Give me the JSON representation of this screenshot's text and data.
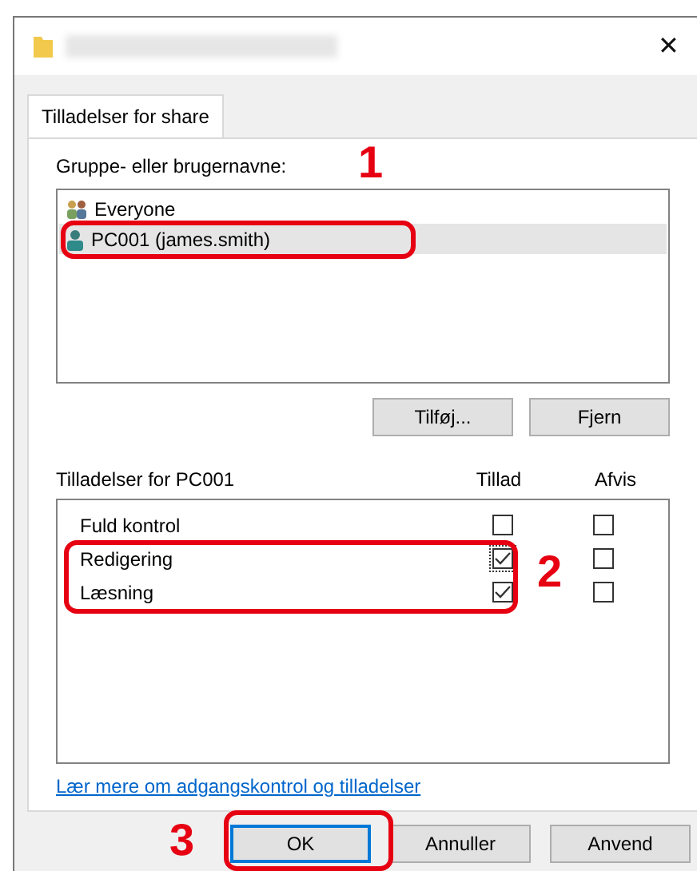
{
  "window": {
    "close": "✕"
  },
  "tabs": [
    {
      "label": "Tilladelser for share",
      "selected": true
    }
  ],
  "users": {
    "label": "Gruppe- eller brugernavne:",
    "items": [
      {
        "name": "Everyone",
        "kind": "group",
        "selected": false
      },
      {
        "name": "PC001 (james.smith)",
        "kind": "user",
        "selected": true
      }
    ],
    "buttons": [
      "Tilføj...",
      "Fjern"
    ]
  },
  "permissions": {
    "label": "Tilladelser for PC001",
    "columns": [
      "Tillad",
      "Afvis"
    ],
    "rows": [
      {
        "name": "Fuld kontrol",
        "allow": false,
        "deny": false,
        "focused": false
      },
      {
        "name": "Redigering",
        "allow": true,
        "deny": false,
        "focused": true
      },
      {
        "name": "Læsning",
        "allow": true,
        "deny": false,
        "focused": false
      }
    ]
  },
  "link": "Lær mere om adgangskontrol og tilladelser",
  "buttons": [
    {
      "label": "OK",
      "default": true
    },
    {
      "label": "Annuller",
      "default": false
    },
    {
      "label": "Anvend",
      "default": false
    }
  ],
  "annotations": [
    {
      "label": "1"
    },
    {
      "label": "2"
    },
    {
      "label": "3"
    }
  ]
}
